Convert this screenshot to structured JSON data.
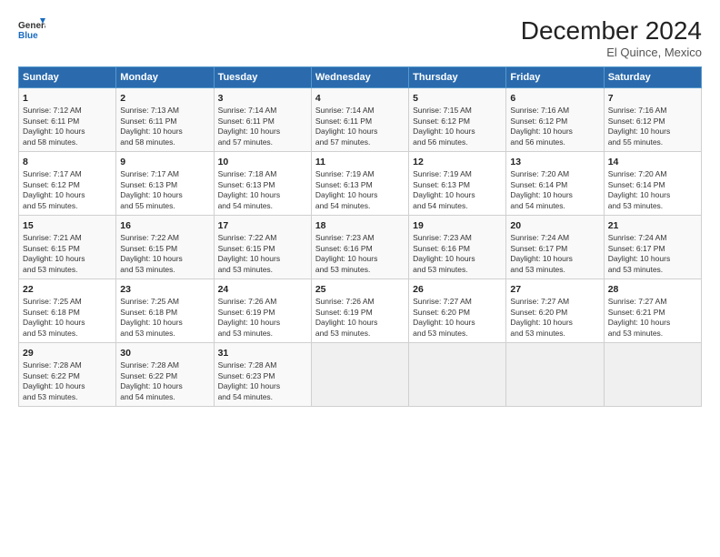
{
  "header": {
    "logo_line1": "General",
    "logo_line2": "Blue",
    "month_title": "December 2024",
    "location": "El Quince, Mexico"
  },
  "days_of_week": [
    "Sunday",
    "Monday",
    "Tuesday",
    "Wednesday",
    "Thursday",
    "Friday",
    "Saturday"
  ],
  "weeks": [
    [
      {
        "day": "1",
        "info": "Sunrise: 7:12 AM\nSunset: 6:11 PM\nDaylight: 10 hours\nand 58 minutes."
      },
      {
        "day": "2",
        "info": "Sunrise: 7:13 AM\nSunset: 6:11 PM\nDaylight: 10 hours\nand 58 minutes."
      },
      {
        "day": "3",
        "info": "Sunrise: 7:14 AM\nSunset: 6:11 PM\nDaylight: 10 hours\nand 57 minutes."
      },
      {
        "day": "4",
        "info": "Sunrise: 7:14 AM\nSunset: 6:11 PM\nDaylight: 10 hours\nand 57 minutes."
      },
      {
        "day": "5",
        "info": "Sunrise: 7:15 AM\nSunset: 6:12 PM\nDaylight: 10 hours\nand 56 minutes."
      },
      {
        "day": "6",
        "info": "Sunrise: 7:16 AM\nSunset: 6:12 PM\nDaylight: 10 hours\nand 56 minutes."
      },
      {
        "day": "7",
        "info": "Sunrise: 7:16 AM\nSunset: 6:12 PM\nDaylight: 10 hours\nand 55 minutes."
      }
    ],
    [
      {
        "day": "8",
        "info": "Sunrise: 7:17 AM\nSunset: 6:12 PM\nDaylight: 10 hours\nand 55 minutes."
      },
      {
        "day": "9",
        "info": "Sunrise: 7:17 AM\nSunset: 6:13 PM\nDaylight: 10 hours\nand 55 minutes."
      },
      {
        "day": "10",
        "info": "Sunrise: 7:18 AM\nSunset: 6:13 PM\nDaylight: 10 hours\nand 54 minutes."
      },
      {
        "day": "11",
        "info": "Sunrise: 7:19 AM\nSunset: 6:13 PM\nDaylight: 10 hours\nand 54 minutes."
      },
      {
        "day": "12",
        "info": "Sunrise: 7:19 AM\nSunset: 6:13 PM\nDaylight: 10 hours\nand 54 minutes."
      },
      {
        "day": "13",
        "info": "Sunrise: 7:20 AM\nSunset: 6:14 PM\nDaylight: 10 hours\nand 54 minutes."
      },
      {
        "day": "14",
        "info": "Sunrise: 7:20 AM\nSunset: 6:14 PM\nDaylight: 10 hours\nand 53 minutes."
      }
    ],
    [
      {
        "day": "15",
        "info": "Sunrise: 7:21 AM\nSunset: 6:15 PM\nDaylight: 10 hours\nand 53 minutes."
      },
      {
        "day": "16",
        "info": "Sunrise: 7:22 AM\nSunset: 6:15 PM\nDaylight: 10 hours\nand 53 minutes."
      },
      {
        "day": "17",
        "info": "Sunrise: 7:22 AM\nSunset: 6:15 PM\nDaylight: 10 hours\nand 53 minutes."
      },
      {
        "day": "18",
        "info": "Sunrise: 7:23 AM\nSunset: 6:16 PM\nDaylight: 10 hours\nand 53 minutes."
      },
      {
        "day": "19",
        "info": "Sunrise: 7:23 AM\nSunset: 6:16 PM\nDaylight: 10 hours\nand 53 minutes."
      },
      {
        "day": "20",
        "info": "Sunrise: 7:24 AM\nSunset: 6:17 PM\nDaylight: 10 hours\nand 53 minutes."
      },
      {
        "day": "21",
        "info": "Sunrise: 7:24 AM\nSunset: 6:17 PM\nDaylight: 10 hours\nand 53 minutes."
      }
    ],
    [
      {
        "day": "22",
        "info": "Sunrise: 7:25 AM\nSunset: 6:18 PM\nDaylight: 10 hours\nand 53 minutes."
      },
      {
        "day": "23",
        "info": "Sunrise: 7:25 AM\nSunset: 6:18 PM\nDaylight: 10 hours\nand 53 minutes."
      },
      {
        "day": "24",
        "info": "Sunrise: 7:26 AM\nSunset: 6:19 PM\nDaylight: 10 hours\nand 53 minutes."
      },
      {
        "day": "25",
        "info": "Sunrise: 7:26 AM\nSunset: 6:19 PM\nDaylight: 10 hours\nand 53 minutes."
      },
      {
        "day": "26",
        "info": "Sunrise: 7:27 AM\nSunset: 6:20 PM\nDaylight: 10 hours\nand 53 minutes."
      },
      {
        "day": "27",
        "info": "Sunrise: 7:27 AM\nSunset: 6:20 PM\nDaylight: 10 hours\nand 53 minutes."
      },
      {
        "day": "28",
        "info": "Sunrise: 7:27 AM\nSunset: 6:21 PM\nDaylight: 10 hours\nand 53 minutes."
      }
    ],
    [
      {
        "day": "29",
        "info": "Sunrise: 7:28 AM\nSunset: 6:22 PM\nDaylight: 10 hours\nand 53 minutes."
      },
      {
        "day": "30",
        "info": "Sunrise: 7:28 AM\nSunset: 6:22 PM\nDaylight: 10 hours\nand 54 minutes."
      },
      {
        "day": "31",
        "info": "Sunrise: 7:28 AM\nSunset: 6:23 PM\nDaylight: 10 hours\nand 54 minutes."
      },
      {
        "day": "",
        "info": ""
      },
      {
        "day": "",
        "info": ""
      },
      {
        "day": "",
        "info": ""
      },
      {
        "day": "",
        "info": ""
      }
    ]
  ]
}
